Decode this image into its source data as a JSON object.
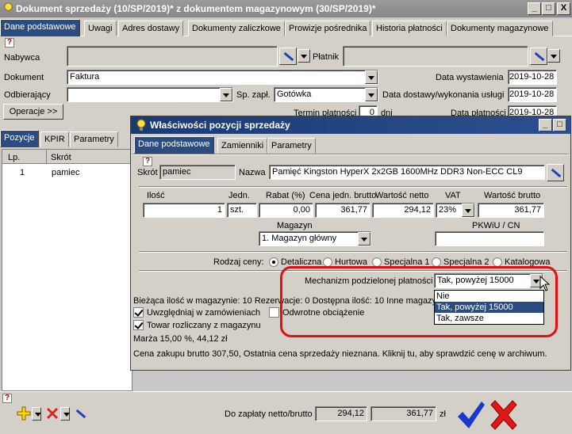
{
  "window": {
    "title": "Dokument sprzedaży (10/SP/2019)* z dokumentem magazynowym (30/SP/2019)*",
    "minimize": "_",
    "maximize": "□",
    "close": "X"
  },
  "main_tabs": [
    {
      "label": "Dane podstawowe"
    },
    {
      "label": "Uwagi"
    },
    {
      "label": "Adres dostawy"
    },
    {
      "label": "Dokumenty zaliczkowe"
    },
    {
      "label": "Prowizje pośrednika"
    },
    {
      "label": "Historia płatności"
    },
    {
      "label": "Dokumenty magazynowe"
    }
  ],
  "form": {
    "help": "?",
    "nabywca_label": "Nabywca",
    "platnik_label": "Płatnik",
    "dokument_label": "Dokument",
    "dokument_value": "Faktura",
    "odbierajacy_label": "Odbierający",
    "sp_zapl_label": "Sp. zapł.",
    "sp_zapl_value": "Gotówka",
    "operacje_button": "Operacje >>",
    "termin_label": "Termin płatności",
    "termin_value": "0",
    "dni_label": "dni",
    "data_wystawienia_label": "Data wystawienia",
    "data_wystawienia_value": "2019-10-28",
    "data_dostawy_label": "Data dostawy/wykonania usługi",
    "data_dostawy_value": "2019-10-28",
    "data_sprzedazy_label": "Data płatności",
    "data_sprzedazy_value": "2019-10-28"
  },
  "lower_tabs": [
    {
      "label": "Pozycje"
    },
    {
      "label": "KPIR"
    },
    {
      "label": "Parametry"
    }
  ],
  "positions_table": {
    "headers": [
      "Lp.",
      "Skrót"
    ],
    "rows": [
      {
        "lp": "1",
        "skrot": "pamiec"
      }
    ]
  },
  "bottom": {
    "help": "?",
    "do_zaplaty_label": "Do zapłaty netto/brutto",
    "netto": "294,12",
    "brutto": "361,77",
    "currency": "zł"
  },
  "dialog": {
    "title": "Właściwości pozycji sprzedaży",
    "minimize": "_",
    "maximize": "□",
    "close": "X",
    "tabs": [
      {
        "label": "Dane podstawowe"
      },
      {
        "label": "Zamienniki"
      },
      {
        "label": "Parametry"
      }
    ],
    "help": "?",
    "skrot_label": "Skrót",
    "skrot_value": "pamiec",
    "nazwa_label": "Nazwa",
    "nazwa_value": "Pamięć Kingston HyperX 2x2GB 1600MHz DDR3 Non-ECC CL9",
    "ilosc_label": "Ilość",
    "ilosc_value": "1",
    "jedn_label": "Jedn.",
    "jedn_value": "szt.",
    "rabat_label": "Rabat (%)",
    "rabat_value": "0,00",
    "cena_label": "Cena jedn. brutto",
    "cena_value": "361,77",
    "wartosc_netto_label": "Wartość netto",
    "wartosc_netto_value": "294,12",
    "vat_label": "VAT",
    "vat_value": "23%",
    "wartosc_brutto_label": "Wartość brutto",
    "wartosc_brutto_value": "361,77",
    "magazyn_label": "Magazyn",
    "magazyn_value": "1. Magazyn główny",
    "pkwiu_label": "PKWiU / CN",
    "pkwiu_value": "",
    "rodzaj_ceny_label": "Rodzaj ceny:",
    "price_types": [
      {
        "label": "Detaliczna",
        "selected": true
      },
      {
        "label": "Hurtowa",
        "selected": false
      },
      {
        "label": "Specjalna 1",
        "selected": false
      },
      {
        "label": "Specjalna 2",
        "selected": false
      },
      {
        "label": "Katalogowa",
        "selected": false
      }
    ],
    "mpp_label": "Mechanizm podzielonej płatności",
    "mpp_value": "Tak, powyżej 15000",
    "mpp_options": [
      "Nie",
      "Tak, powyżej 15000",
      "Tak, zawsze"
    ],
    "mpp_selected_index": 1,
    "stock_info": "Bieżąca ilość w magazynie: 10 Rezerwacje: 0 Dostępna ilość: 10 Inne magazyny",
    "uwzgledniaj_label": "Uwzględniaj w zamówieniach",
    "uwzgledniaj_checked": true,
    "odwrotne_label": "Odwrotne obciążenie",
    "odwrotne_checked": false,
    "towar_label": "Towar rozliczany z magazynu",
    "towar_checked": true,
    "marza_text": "Marża 15,00 %, 44,12 zł",
    "cena_zakupu_text": "Cena zakupu brutto 307,50, Ostatnia cena sprzedaży nieznana. Kliknij tu, aby sprawdzić cenę w archiwum."
  },
  "colors": {
    "accent": "#2b4c80",
    "highlight_ring": "#e01010"
  }
}
